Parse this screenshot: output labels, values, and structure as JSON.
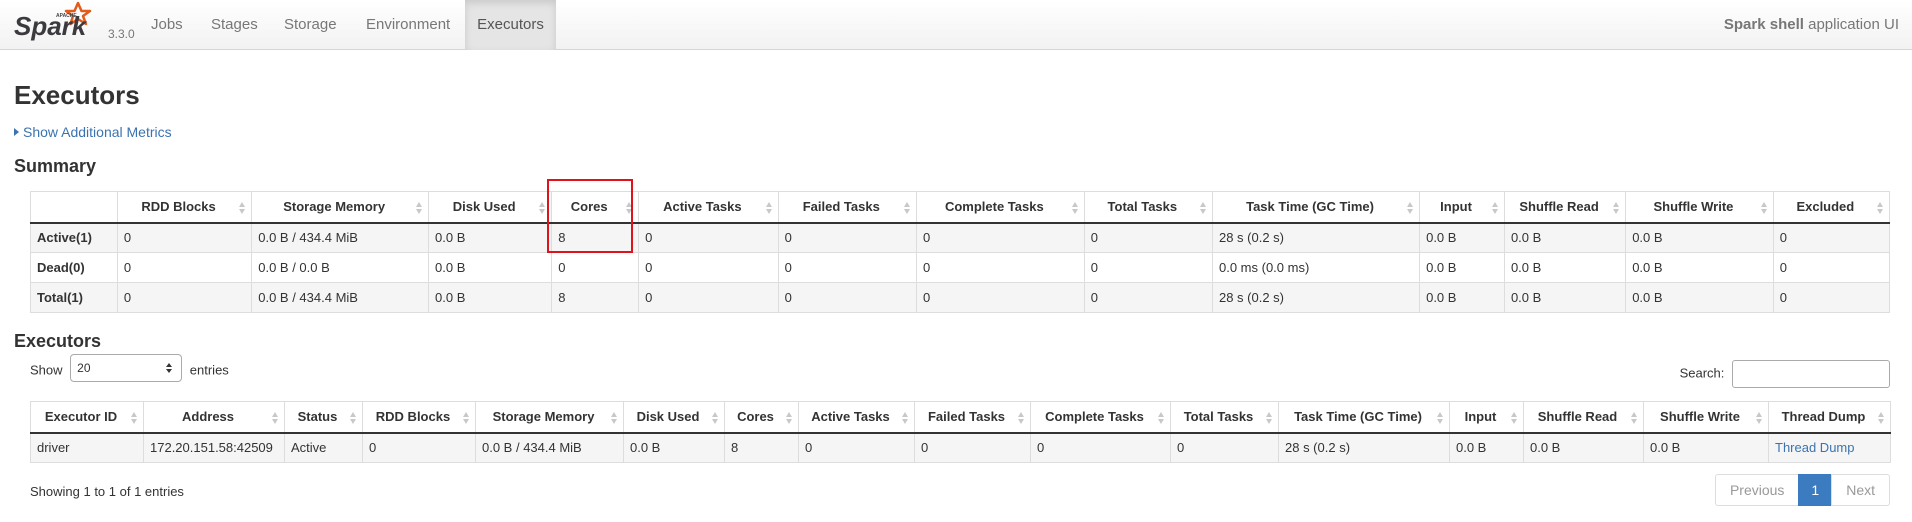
{
  "navbar": {
    "brand_version": "3.3.0",
    "tabs": [
      {
        "label": "Jobs"
      },
      {
        "label": "Stages"
      },
      {
        "label": "Storage"
      },
      {
        "label": "Environment"
      },
      {
        "label": "Executors"
      }
    ],
    "active_tab": "Executors",
    "app_name": "Spark shell",
    "app_suffix": "application UI"
  },
  "page_title": "Executors",
  "additional_metrics_link": "Show Additional Metrics",
  "summary": {
    "title": "Summary",
    "columns": [
      "RDD Blocks",
      "Storage Memory",
      "Disk Used",
      "Cores",
      "Active Tasks",
      "Failed Tasks",
      "Complete Tasks",
      "Total Tasks",
      "Task Time (GC Time)",
      "Input",
      "Shuffle Read",
      "Shuffle Write",
      "Excluded"
    ],
    "rows": [
      {
        "label": "Active(1)",
        "cells": [
          "0",
          "0.0 B / 434.4 MiB",
          "0.0 B",
          "8",
          "0",
          "0",
          "0",
          "0",
          "28 s (0.2 s)",
          "0.0 B",
          "0.0 B",
          "0.0 B",
          "0"
        ]
      },
      {
        "label": "Dead(0)",
        "cells": [
          "0",
          "0.0 B / 0.0 B",
          "0.0 B",
          "0",
          "0",
          "0",
          "0",
          "0",
          "0.0 ms (0.0 ms)",
          "0.0 B",
          "0.0 B",
          "0.0 B",
          "0"
        ]
      },
      {
        "label": "Total(1)",
        "cells": [
          "0",
          "0.0 B / 434.4 MiB",
          "0.0 B",
          "8",
          "0",
          "0",
          "0",
          "0",
          "28 s (0.2 s)",
          "0.0 B",
          "0.0 B",
          "0.0 B",
          "0"
        ]
      }
    ],
    "highlighted_column": "Cores"
  },
  "executors": {
    "title": "Executors",
    "length_prefix": "Show",
    "length_value": "20",
    "length_suffix": "entries",
    "search_label": "Search:",
    "columns": [
      "Executor ID",
      "Address",
      "Status",
      "RDD Blocks",
      "Storage Memory",
      "Disk Used",
      "Cores",
      "Active Tasks",
      "Failed Tasks",
      "Complete Tasks",
      "Total Tasks",
      "Task Time (GC Time)",
      "Input",
      "Shuffle Read",
      "Shuffle Write",
      "Thread Dump"
    ],
    "rows": [
      {
        "cells": [
          "driver",
          "172.20.151.58:42509",
          "Active",
          "0",
          "0.0 B / 434.4 MiB",
          "0.0 B",
          "8",
          "0",
          "0",
          "0",
          "0",
          "28 s (0.2 s)",
          "0.0 B",
          "0.0 B",
          "0.0 B",
          "Thread Dump"
        ]
      }
    ],
    "info": "Showing 1 to 1 of 1 entries",
    "pagination": {
      "previous": "Previous",
      "current_page": "1",
      "next": "Next"
    }
  },
  "colors": {
    "link": "#3b73af",
    "highlight_box": "#e0121b",
    "pagination_active": "#3b7bbf",
    "spark_logo_orange": "#e25a1c"
  }
}
